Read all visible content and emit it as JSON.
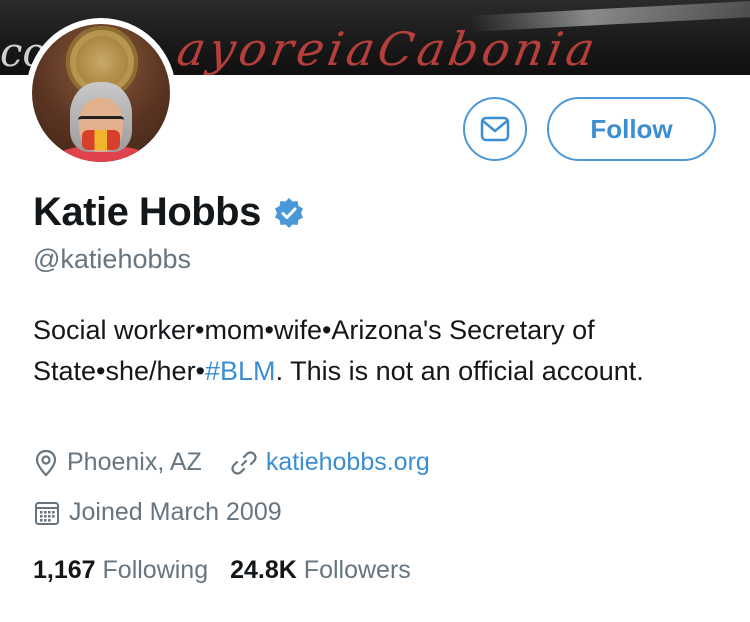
{
  "banner": {
    "script_text": "ayoreiaCabonia",
    "left_text": "co"
  },
  "profile": {
    "name": "Katie Hobbs",
    "handle": "@katiehobbs",
    "verified": true,
    "bio_parts": {
      "before_hashtag": "Social worker•mom•wife•Arizona's Secretary of State•she/her•",
      "hashtag": "#BLM",
      "after_hashtag": ". This is not an official account."
    },
    "location": "Phoenix, AZ",
    "website": "katiehobbs.org",
    "joined": "Joined March 2009"
  },
  "actions": {
    "message_icon": "envelope-icon",
    "follow_label": "Follow"
  },
  "stats": {
    "following_count": "1,167",
    "following_label": "Following",
    "followers_count": "24.8K",
    "followers_label": "Followers"
  },
  "colors": {
    "accent": "#3c8ed2",
    "secondary_text": "#66757f",
    "primary_text": "#14171a"
  }
}
